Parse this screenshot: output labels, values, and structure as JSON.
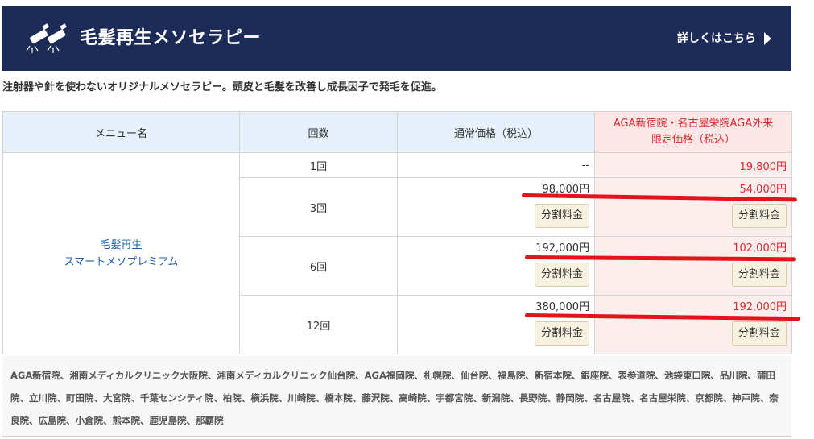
{
  "header": {
    "title": "毛髪再生メソセラピー",
    "more_label": "詳しくはこちら"
  },
  "description": "注射器や針を使わないオリジナルメソセラピー。頭皮と毛髪を改善し成長因子で発毛を促進。",
  "table": {
    "headers": {
      "menu": "メニュー名",
      "count": "回数",
      "normal": "通常価格（税込）",
      "aga_line1": "AGA新宿院・名古屋栄院AGA外来",
      "aga_line2": "限定価格（税込）"
    },
    "menu_name_line1": "毛髪再生",
    "menu_name_line2": "スマートメソプレミアム",
    "rows": [
      {
        "count": "1回",
        "normal": "--",
        "aga": "19,800円"
      },
      {
        "count": "3回",
        "normal": "98,000円",
        "aga": "54,000円",
        "button": "分割料金"
      },
      {
        "count": "6回",
        "normal": "192,000円",
        "aga": "102,000円",
        "button": "分割料金"
      },
      {
        "count": "12回",
        "normal": "380,000円",
        "aga": "192,000円",
        "button": "分割料金"
      }
    ]
  },
  "clinics": "AGA新宿院、湘南メディカルクリニック大阪院、湘南メディカルクリニック仙台院、AGA福岡院、札幌院、仙台院、福島院、新宿本院、銀座院、表参道院、池袋東口院、品川院、蒲田院、立川院、町田院、大宮院、千葉センシティ院、柏院、横浜院、川崎院、橋本院、藤沢院、高崎院、宇都宮院、新潟院、長野院、静岡院、名古屋院、名古屋栄院、京都院、神戸院、奈良院、広島院、小倉院、熊本院、鹿児島院、那覇院",
  "colors": {
    "header_bg": "#1c2b57",
    "accent_red": "#d9282f",
    "highlight_line": "#e3131b",
    "table_head_bg": "#e6f0fa",
    "aga_bg": "#fdeeee"
  }
}
